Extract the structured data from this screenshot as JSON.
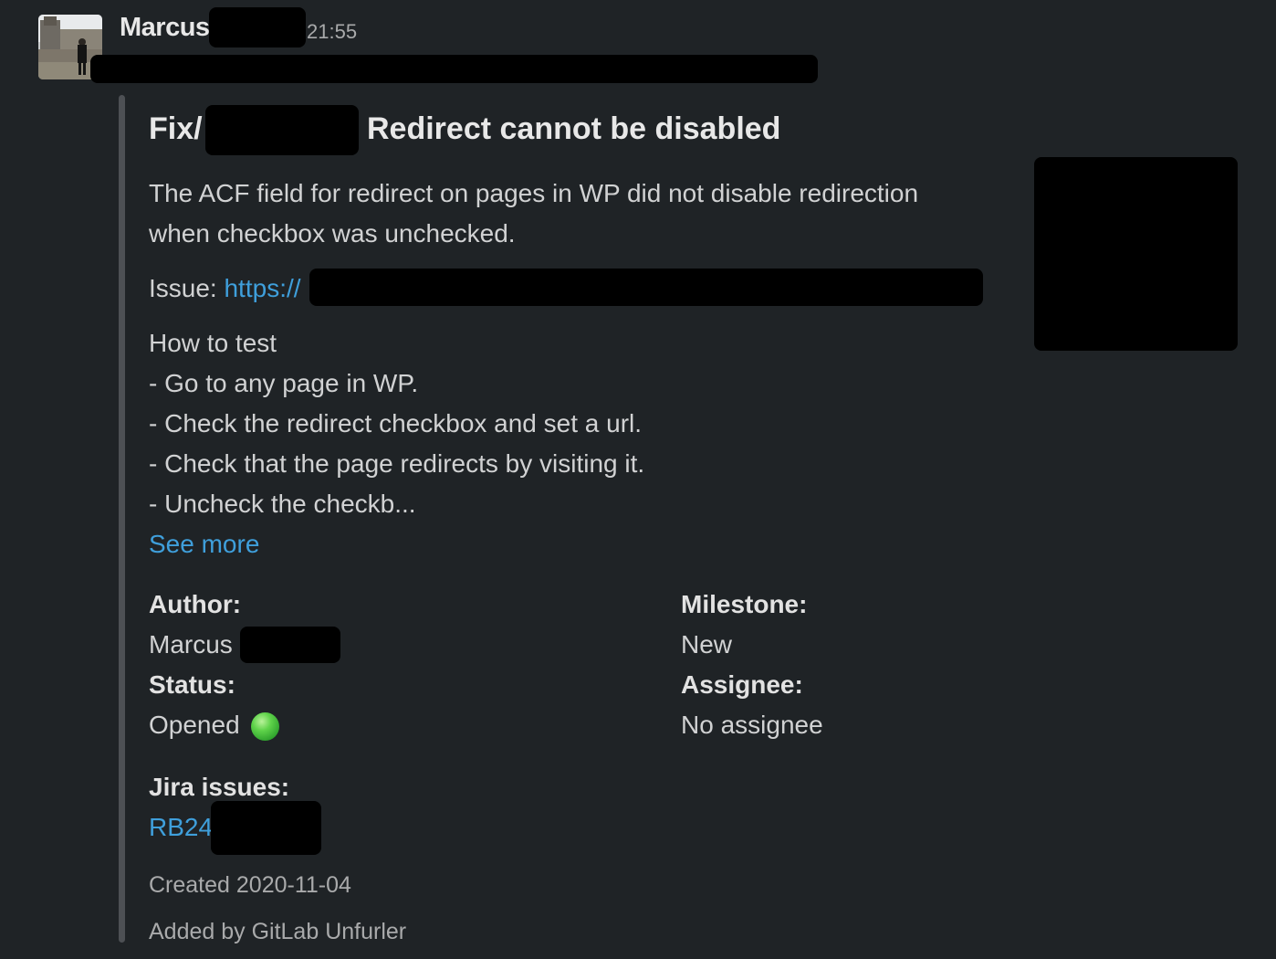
{
  "message": {
    "sender": "Marcus",
    "time": "21:55",
    "avatar_icon": "person-photo-avatar"
  },
  "attachment": {
    "title_prefix": "Fix/",
    "title_suffix": "Redirect cannot be disabled",
    "description_line1": "The ACF field for redirect on pages in WP did not disable redirection",
    "description_line2": "when checkbox was unchecked.",
    "issue_label": "Issue:",
    "issue_link": "https://",
    "how_to_test": [
      "How to test",
      "- Go to any page in WP.",
      "- Check the redirect checkbox and set a url.",
      "- Check that the page redirects by visiting it.",
      "- Uncheck the checkb..."
    ],
    "see_more": "See more",
    "fields": {
      "author_label": "Author:",
      "author_value": "Marcus",
      "milestone_label": "Milestone:",
      "milestone_value": "New",
      "status_label": "Status:",
      "status_value": "Opened",
      "status_icon": "green-circle-icon",
      "assignee_label": "Assignee:",
      "assignee_value": "No assignee"
    },
    "jira_label": "Jira issues:",
    "jira_value": "RB24",
    "created": "Created 2020-11-04",
    "added_by": "Added by GitLab Unfurler",
    "colors": {
      "background": "#1f2326",
      "link": "#3f9fdb",
      "accent_bar": "#4d5054",
      "status_green": "#2a9d2a"
    }
  }
}
